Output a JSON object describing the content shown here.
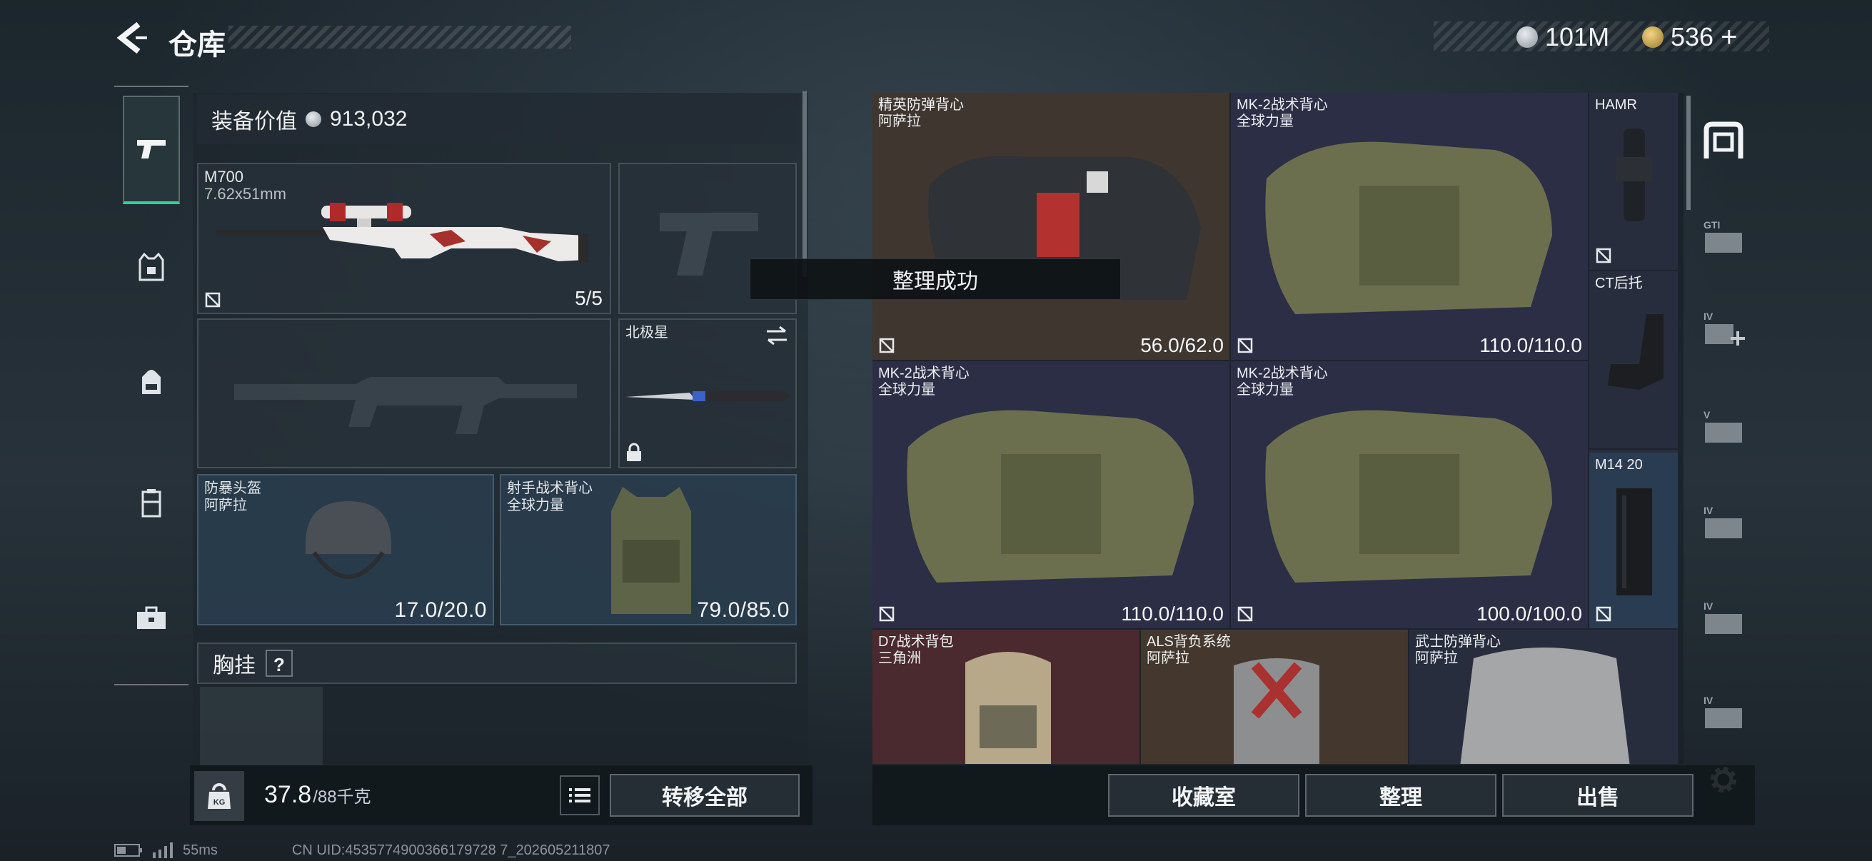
{
  "header": {
    "title": "仓库"
  },
  "currency": {
    "coins": "101M",
    "tokens": "536",
    "add_symbol": "+"
  },
  "equipment": {
    "value_label": "装备价值",
    "value": "913,032",
    "primary_weapon": {
      "name": "M700",
      "caliber": "7.62x51mm",
      "ammo": "5/5"
    },
    "melee": {
      "name": "北极星"
    },
    "helmet": {
      "name": "防暴头盔",
      "brand": "阿萨拉",
      "durability": "17.0/20.0"
    },
    "armor": {
      "name": "射手战术背心",
      "brand": "全球力量",
      "durability": "79.0/85.0"
    },
    "chest_rig": {
      "label": "胸挂",
      "help": "?"
    }
  },
  "weight": {
    "current": "37.8",
    "max": "/88千克",
    "kg_label": "KG"
  },
  "buttons": {
    "transfer_all": "转移全部",
    "collection": "收藏室",
    "sort": "整理",
    "sell": "出售"
  },
  "toast": "整理成功",
  "stash_items": [
    {
      "name": "精英防弹背心",
      "brand": "阿萨拉",
      "durability": "56.0/62.0"
    },
    {
      "name": "MK-2战术背心",
      "brand": "全球力量",
      "durability": "110.0/110.0"
    },
    {
      "name": "HAMR",
      "brand": "",
      "durability": ""
    },
    {
      "name": "CT后托",
      "brand": "",
      "durability": ""
    },
    {
      "name": "MK-2战术背心",
      "brand": "全球力量",
      "durability": "110.0/110.0"
    },
    {
      "name": "MK-2战术背心",
      "brand": "全球力量",
      "durability": "100.0/100.0"
    },
    {
      "name": "M14 20",
      "brand": "",
      "durability": ""
    },
    {
      "name": "D7战术背包",
      "brand": "三角洲",
      "durability": ""
    },
    {
      "name": "ALS背负系统",
      "brand": "阿萨拉",
      "durability": ""
    },
    {
      "name": "武士防弹背心",
      "brand": "阿萨拉",
      "durability": ""
    }
  ],
  "right_rail": [
    "GTI",
    "IV",
    "V",
    "IV",
    "IV",
    "IV"
  ],
  "status": {
    "ping": "55ms",
    "uid": "CN UID:4535774900366179728 7_202605211807"
  },
  "colors": {
    "accent": "#2fd39a"
  }
}
